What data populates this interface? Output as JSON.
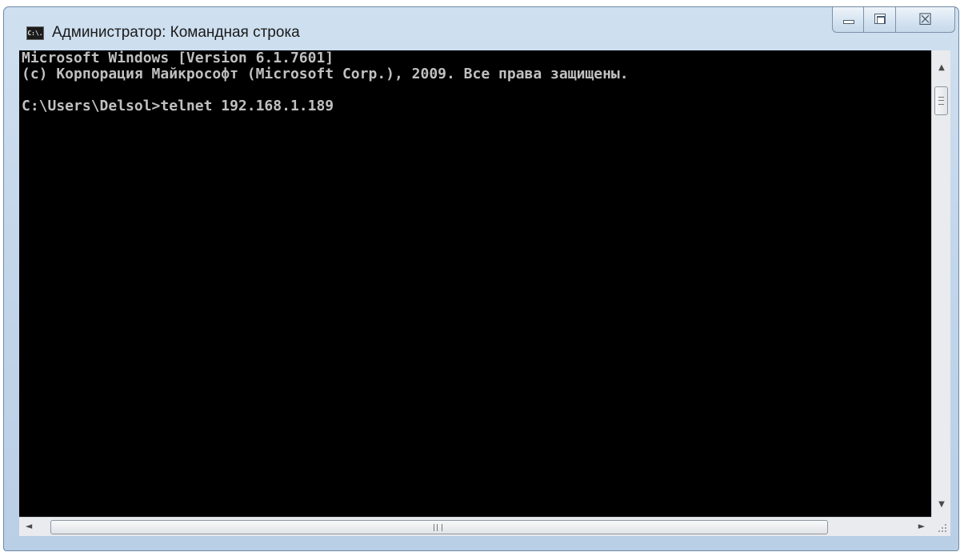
{
  "window": {
    "title": "Администратор: Командная строка",
    "icon_text": "C:\\."
  },
  "caption_buttons": {
    "minimize": "minimize-icon",
    "maximize": "maximize-icon",
    "close": "close-icon",
    "close_glyph": "☒"
  },
  "console": {
    "lines": [
      "Microsoft Windows [Version 6.1.7601]",
      "(c) Корпорация Майкрософт (Microsoft Corp.), 2009. Все права защищены.",
      "",
      "C:\\Users\\Delsol>telnet 192.168.1.189"
    ],
    "text_color": "#c0c0c0",
    "background_color": "#000000"
  },
  "scrollbars": {
    "up_arrow": "▲",
    "down_arrow": "▼",
    "left_arrow": "◄",
    "right_arrow": "►"
  }
}
